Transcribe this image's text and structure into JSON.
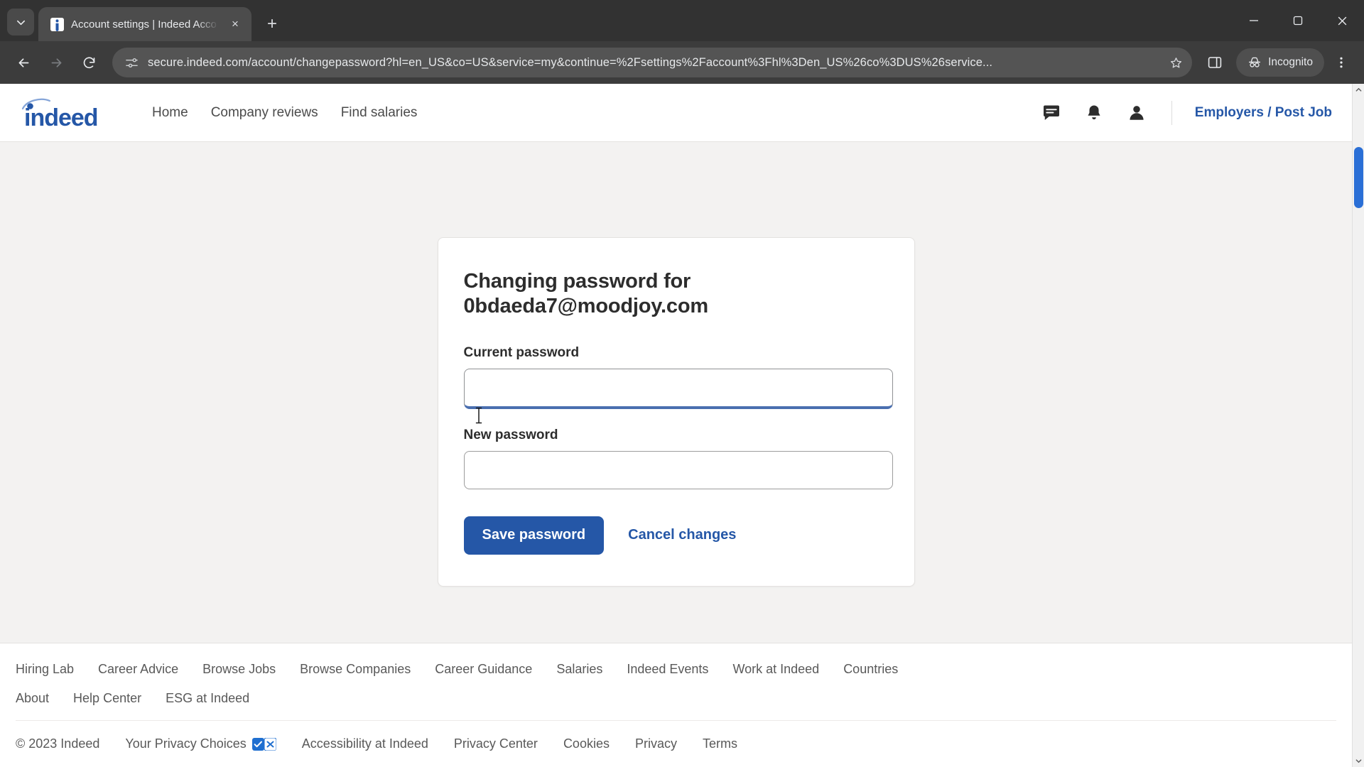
{
  "browser": {
    "tab": {
      "title": "Account settings | Indeed Acco",
      "favicon_name": "indeed-favicon",
      "close_label": "×",
      "newtab_label": "+"
    },
    "tab_search_label": "∨",
    "window_controls": {
      "minimize": "—",
      "maximize": "❐",
      "close": "✕"
    },
    "toolbar": {
      "back_label": "←",
      "forward_label": "→",
      "reload_label": "↻",
      "url": "secure.indeed.com/account/changepassword?hl=en_US&co=US&service=my&continue=%2Fsettings%2Faccount%3Fhl%3Den_US%26co%3DUS%26service...",
      "site_info_icon": "tune-icon",
      "bookmark_label": "☆",
      "side_panel_icon": "side-panel-icon",
      "incognito_label": "Incognito",
      "menu_label": "⋮"
    }
  },
  "site_header": {
    "logo_text": "indeed",
    "nav": [
      {
        "label": "Home"
      },
      {
        "label": "Company reviews"
      },
      {
        "label": "Find salaries"
      }
    ],
    "icons": [
      {
        "name": "messages-icon"
      },
      {
        "name": "notifications-icon"
      },
      {
        "name": "account-icon"
      }
    ],
    "employers_label": "Employers / Post Job"
  },
  "card": {
    "title_line1": "Changing password for",
    "title_line2": "0bdaeda7@moodjoy.com",
    "email": "0bdaeda7@moodjoy.com",
    "fields": [
      {
        "label": "Current password",
        "value": "",
        "placeholder": "",
        "focused": true
      },
      {
        "label": "New password",
        "value": "",
        "placeholder": "",
        "focused": false
      }
    ],
    "save_label": "Save password",
    "cancel_label": "Cancel changes"
  },
  "footer": {
    "row1": [
      "Hiring Lab",
      "Career Advice",
      "Browse Jobs",
      "Browse Companies",
      "Career Guidance",
      "Salaries",
      "Indeed Events",
      "Work at Indeed",
      "Countries"
    ],
    "row2": [
      "About",
      "Help Center",
      "ESG at Indeed"
    ],
    "copyright": "© 2023 Indeed",
    "privacy_choices_label": "Your Privacy Choices",
    "bottom_links": [
      "Accessibility at Indeed",
      "Privacy Center",
      "Cookies",
      "Privacy",
      "Terms"
    ]
  },
  "colors": {
    "indeed_blue": "#2557a7",
    "page_bg": "#f3f2f1",
    "focus_underline": "#4a6fb0",
    "scrollbar_thumb": "#2a6fd6"
  }
}
